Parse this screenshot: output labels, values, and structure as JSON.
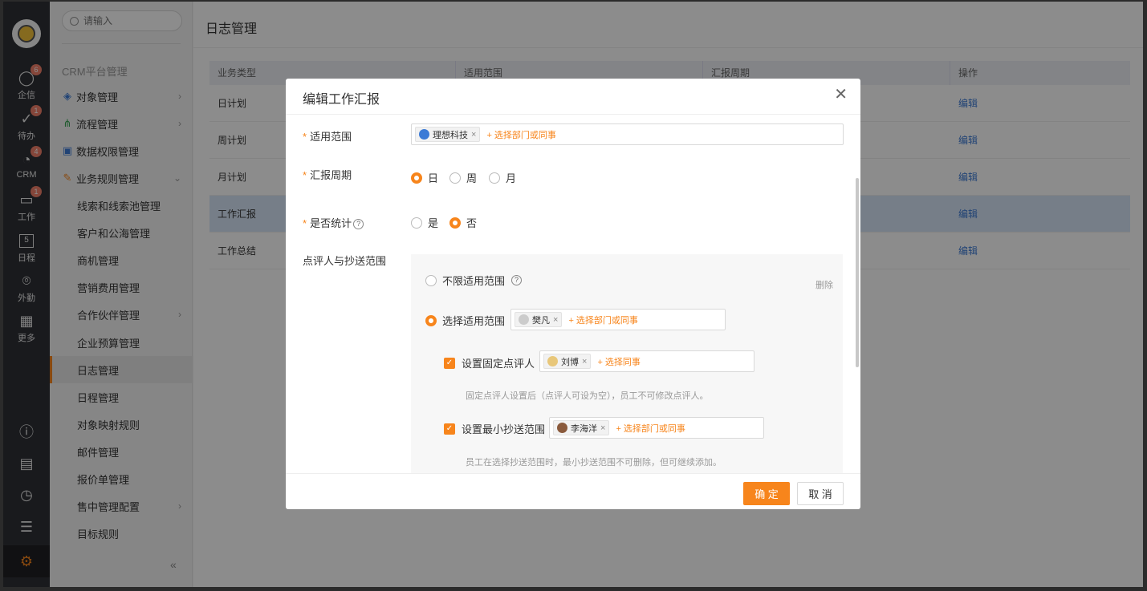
{
  "rail": {
    "items": [
      {
        "label": "企信",
        "badge": "6"
      },
      {
        "label": "待办",
        "badge": "1"
      },
      {
        "label": "CRM",
        "badge": "4"
      },
      {
        "label": "工作",
        "badge": "1"
      },
      {
        "label": "日程",
        "badge": "5"
      },
      {
        "label": "外勤",
        "badge": ""
      },
      {
        "label": "更多",
        "badge": ""
      }
    ]
  },
  "menu": {
    "search_placeholder": "请输入",
    "section": "CRM平台管理",
    "items": [
      {
        "label": "对象管理"
      },
      {
        "label": "流程管理"
      },
      {
        "label": "数据权限管理"
      },
      {
        "label": "业务规则管理"
      },
      {
        "label": "线索和线索池管理"
      },
      {
        "label": "客户和公海管理"
      },
      {
        "label": "商机管理"
      },
      {
        "label": "营销费用管理"
      },
      {
        "label": "合作伙伴管理"
      },
      {
        "label": "企业预算管理"
      },
      {
        "label": "日志管理"
      },
      {
        "label": "日程管理"
      },
      {
        "label": "对象映射规则"
      },
      {
        "label": "邮件管理"
      },
      {
        "label": "报价单管理"
      },
      {
        "label": "售中管理配置"
      },
      {
        "label": "目标规则"
      }
    ],
    "collapse": "«"
  },
  "main": {
    "title": "日志管理",
    "columns": [
      "业务类型",
      "适用范围",
      "汇报周期",
      "操作"
    ],
    "rows": [
      {
        "type": "日计划",
        "action": "编辑"
      },
      {
        "type": "周计划",
        "action": "编辑"
      },
      {
        "type": "月计划",
        "action": "编辑"
      },
      {
        "type": "工作汇报",
        "action": "编辑"
      },
      {
        "type": "工作总结",
        "action": "编辑"
      }
    ]
  },
  "modal": {
    "title": "编辑工作汇报",
    "close": "✕",
    "scope_label": "适用范围",
    "scope_tag": "理想科技",
    "scope_add": "+ 选择部门或同事",
    "period_label": "汇报周期",
    "period_options": [
      "日",
      "周",
      "月"
    ],
    "stat_label": "是否统计",
    "stat_options": [
      "是",
      "否"
    ],
    "reviewer_label": "点评人与抄送范围",
    "unlimited": "不限适用范围",
    "delete": "删除",
    "choose_scope": "选择适用范围",
    "choose_tag": "樊凡",
    "choose_add": "+ 选择部门或同事",
    "fixed_reviewer": "设置固定点评人",
    "fixed_tag": "刘博",
    "fixed_add": "+ 选择同事",
    "fixed_hint": "固定点评人设置后（点评人可设为空），员工不可修改点评人。",
    "min_cc": "设置最小抄送范围",
    "min_tag": "李海洋",
    "min_add": "+ 选择部门或同事",
    "min_hint": "员工在选择抄送范围时，最小抄送范围不可删除，但可继续添加。",
    "ok": "确 定",
    "cancel": "取 消",
    "required_mark": "*",
    "help_mark": "?"
  },
  "colors": {
    "accent": "#f7851c",
    "link": "#3c7bd6",
    "rail": "#2f3136"
  }
}
